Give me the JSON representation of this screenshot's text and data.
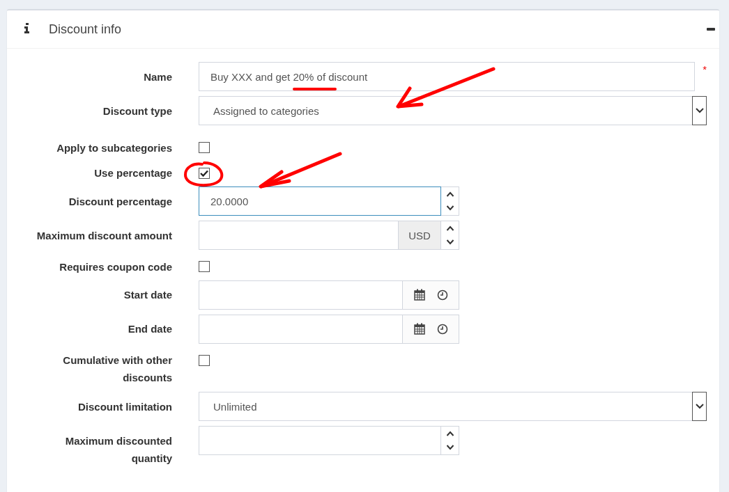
{
  "panel": {
    "title": "Discount info"
  },
  "fields": [
    {
      "kind": "text",
      "label": "Name",
      "value": "Buy XXX and get 20% of discount",
      "required_mark": "*"
    },
    {
      "kind": "select",
      "label": "Discount type",
      "value": "Assigned to categories"
    },
    {
      "kind": "checkbox",
      "label": "Apply to subcategories",
      "checked": false
    },
    {
      "kind": "checkbox",
      "label": "Use percentage",
      "checked": true
    },
    {
      "kind": "number",
      "label": "Discount percentage",
      "value": "20.0000",
      "focused": true
    },
    {
      "kind": "money",
      "label": "Maximum discount amount",
      "unit": "USD",
      "focused": false
    },
    {
      "kind": "checkbox",
      "label": "Requires coupon code",
      "checked": false
    },
    {
      "kind": "date",
      "label": "Start date"
    },
    {
      "kind": "date",
      "label": "End date"
    },
    {
      "kind": "checkbox",
      "label": "Cumulative with other discounts",
      "checked": false
    },
    {
      "kind": "select",
      "label": "Discount limitation",
      "value": "Unlimited"
    },
    {
      "kind": "number",
      "label": "Maximum discounted quantity",
      "focused": false
    }
  ],
  "annotations": [
    {
      "kind": "underline"
    },
    {
      "kind": "arrow"
    },
    {
      "kind": "circle"
    },
    {
      "kind": "arrow"
    }
  ]
}
